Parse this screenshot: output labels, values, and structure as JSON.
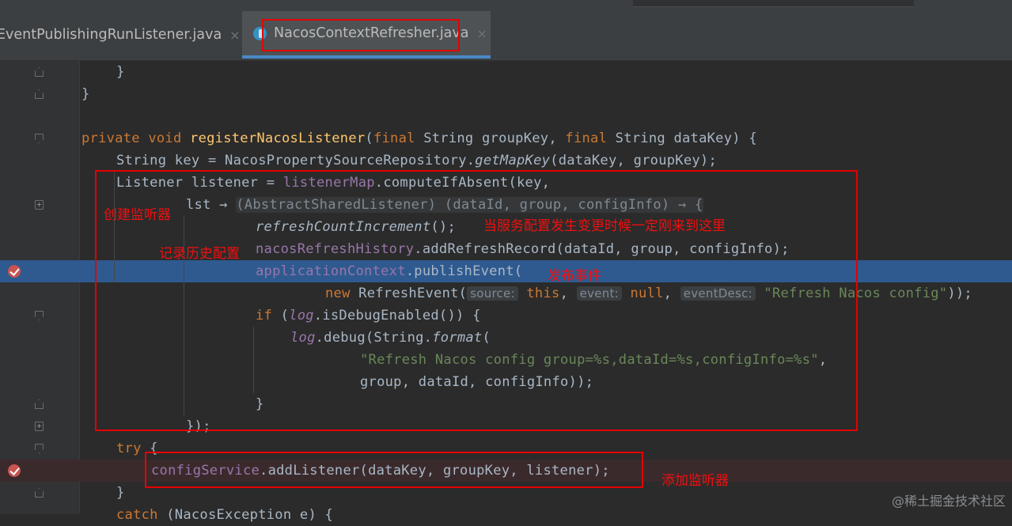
{
  "tabs": [
    {
      "label": "EventPublishingRunListener.java",
      "close": "×"
    },
    {
      "label": "NacosContextRefresher.java",
      "close": "×"
    }
  ],
  "code": {
    "l1": "}",
    "l2": "}",
    "l4": {
      "kw1": "private void ",
      "name": "registerNacosListener",
      "p1": "(",
      "kw2": "final ",
      "p2": "String groupKey, ",
      "kw3": "final ",
      "p3": "String dataKey) {"
    },
    "l5": {
      "a": "String key = NacosPropertySourceRepository.",
      "method": "getMapKey",
      "b": "(dataKey, groupKey);"
    },
    "l6": {
      "a": "Listener listener = ",
      "field": "listenerMap",
      "b": ".computeIfAbsent(key,"
    },
    "l7": {
      "a": "lst → ",
      "hint": "(AbstractSharedListener) (dataId, group, configInfo) → {"
    },
    "l8": {
      "a": "refreshCountIncrement",
      "b": "();"
    },
    "l9": {
      "a": "nacosRefreshHistory",
      "b": ".addRefreshRecord(dataId, group, configInfo);"
    },
    "l10": {
      "a": "applicationContext",
      "b": ".publishEvent("
    },
    "l11": {
      "kw": "new ",
      "cls": "RefreshEvent(",
      "h1": "source:",
      "kw2": "this",
      "c1": ", ",
      "h2": "event:",
      "kw3": "null",
      "c2": ", ",
      "h3": "eventDesc:",
      "str": "\"Refresh Nacos config\"",
      "end": "));"
    },
    "l12": {
      "kw": "if ",
      "a": "(",
      "field": "log",
      "b": ".isDebugEnabled()) {"
    },
    "l13": {
      "field": "log",
      "a": ".debug(String.",
      "method": "format",
      "b": "("
    },
    "l14": {
      "str": "\"Refresh Nacos config group=%s,dataId=%s,configInfo=%s\"",
      "b": ","
    },
    "l15": "group, dataId, configInfo));",
    "l16": "}",
    "l17": "});",
    "l18": {
      "kw": "try ",
      "b": "{"
    },
    "l19": {
      "field": "configService",
      "b": ".addListener(dataKey, groupKey, listener);"
    },
    "l20": "}",
    "l21": {
      "kw": "catch ",
      "b": "(NacosException e) {"
    }
  },
  "annotations": {
    "create_listener": "创建监听器",
    "record_history": "记录历史配置",
    "config_change": "当服务配置发生变更时候一定刚来到这里",
    "publish_event": "发布事件",
    "add_listener": "添加监听器"
  },
  "watermark": "@稀土掘金技术社区",
  "colors": {
    "background": "#2b2b2b",
    "keyword": "#cc7832",
    "method_decl": "#ffc66d",
    "field": "#9876aa",
    "string": "#6a8759",
    "selection": "#2f5a8f",
    "annotation_red": "#e60000",
    "breakpoint": "#c75450"
  },
  "icons": [
    "java-class-icon",
    "breakpoint-icon",
    "fold-icon"
  ]
}
